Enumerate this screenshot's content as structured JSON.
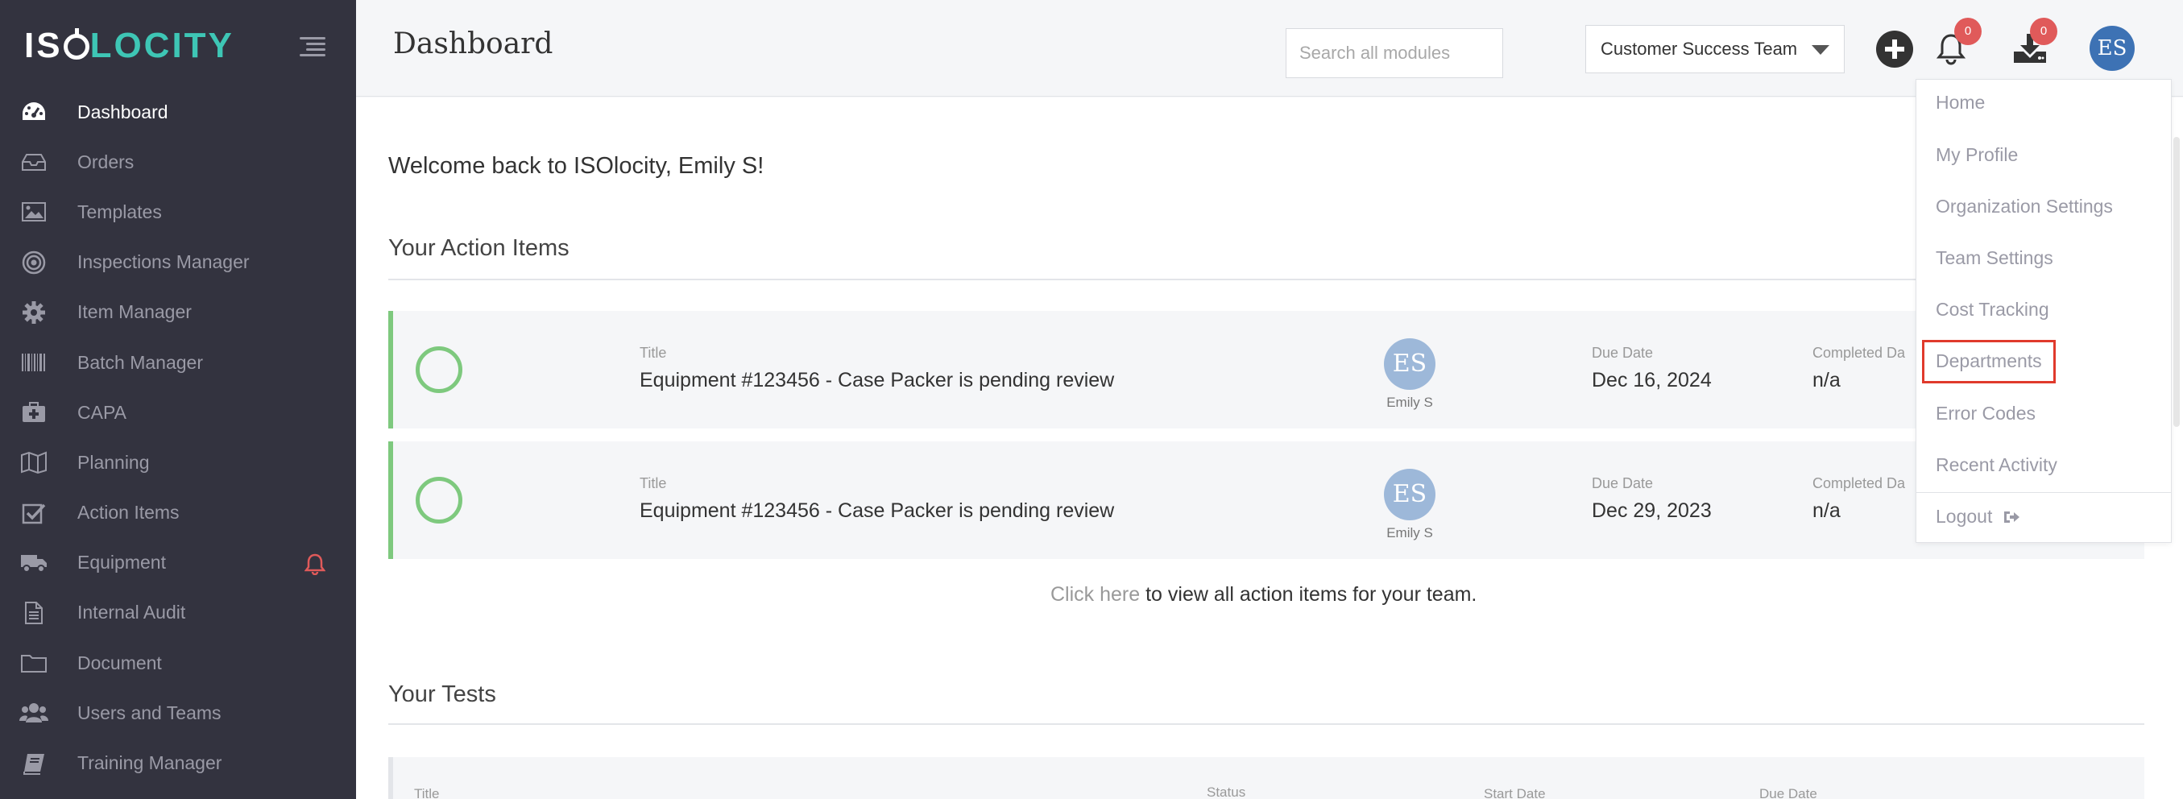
{
  "app": {
    "logo_part1": "IS",
    "logo_part2": "LOCITY",
    "accent_color": "#3ec6b5"
  },
  "sidebar": {
    "items": [
      {
        "label": "Dashboard",
        "icon": "dashboard-gauge-icon",
        "active": true
      },
      {
        "label": "Orders",
        "icon": "inbox-tray-icon"
      },
      {
        "label": "Templates",
        "icon": "image-template-icon"
      },
      {
        "label": "Inspections Manager",
        "icon": "target-icon"
      },
      {
        "label": "Item Manager",
        "icon": "gear-icon"
      },
      {
        "label": "Batch Manager",
        "icon": "barcode-icon"
      },
      {
        "label": "CAPA",
        "icon": "medkit-icon"
      },
      {
        "label": "Planning",
        "icon": "map-icon"
      },
      {
        "label": "Action Items",
        "icon": "check-square-icon"
      },
      {
        "label": "Equipment",
        "icon": "truck-icon",
        "alert_icon": "bell-icon"
      },
      {
        "label": "Internal Audit",
        "icon": "document-icon"
      },
      {
        "label": "Document",
        "icon": "folder-icon"
      },
      {
        "label": "Users and Teams",
        "icon": "users-icon"
      },
      {
        "label": "Training Manager",
        "icon": "book-icon"
      }
    ]
  },
  "header": {
    "title": "Dashboard",
    "search_placeholder": "Search all modules",
    "team_selected": "Customer Success Team",
    "notifications_count": "0",
    "downloads_count": "0",
    "avatar_initials": "ES"
  },
  "main": {
    "welcome": "Welcome back to ISOlocity, Emily S!",
    "action_items_title": "Your Action Items",
    "action_items": [
      {
        "title_label": "Title",
        "title": "Equipment #123456 - Case Packer is pending review",
        "assignee_initials": "ES",
        "assignee_name": "Emily S",
        "due_label": "Due Date",
        "due_date": "Dec 16, 2024",
        "completed_label": "Completed Da",
        "completed": "n/a"
      },
      {
        "title_label": "Title",
        "title": "Equipment #123456 - Case Packer is pending review",
        "assignee_initials": "ES",
        "assignee_name": "Emily S",
        "due_label": "Due Date",
        "due_date": "Dec 29, 2023",
        "completed_label": "Completed Da",
        "completed": "n/a"
      }
    ],
    "click_here": "Click here",
    "click_rest": " to view all action items for your team.",
    "tests_title": "Your Tests",
    "tests_headers": [
      "Title",
      "Status",
      "Start Date",
      "Due Date"
    ]
  },
  "user_menu": {
    "items": [
      "Home",
      "My Profile",
      "Organization Settings",
      "Team Settings",
      "Cost Tracking",
      "Departments",
      "Error Codes",
      "Recent Activity"
    ],
    "logout": "Logout",
    "highlighted": "Departments",
    "highlight_color": "#e03a2c"
  }
}
